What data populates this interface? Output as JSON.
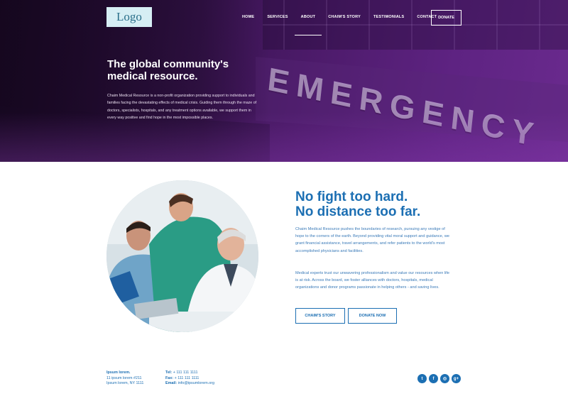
{
  "nav": {
    "logo": "Logo",
    "items": [
      "HOME",
      "SERVICES",
      "ABOUT",
      "CHAIM'S STORY",
      "TESTIMONIALS",
      "CONTACT"
    ],
    "active": "ABOUT",
    "donate_label": "DONATE"
  },
  "hero": {
    "title": "The global community's medical resource.",
    "text": "Chaim Medical Resource is a non-profit organization providing support to individuals and families facing the devastating effects of medical crisis. Guiding them through the maze of doctors, specialists, hospitals, and any treatment options available, we support them in every way positive and find hope in the most impossible places.",
    "background_sign": "EMERGENCY"
  },
  "about": {
    "headline_line1": "No fight too hard.",
    "headline_line2": "No distance too far.",
    "para1": "Chaim Medical Resource pushes the boundaries of research, pursuing any vestige of hope to the corners of the earth. Beyond providing vital moral support and guidance, we grant financial assistance, travel arrangements, and refer patients to the world's most accomplished physicians and facilities.",
    "para2": "Medical experts trust our unwavering professionalism and value our resources when life is at risk. Across the board, we foster alliances with doctors, hospitals, medical organizations and donor programs passionate in helping others - and saving lives.",
    "btn_story": "CHAIM'S STORY",
    "btn_donate": "DONATE NOW"
  },
  "footer": {
    "addr1": "Ipsum lorem.",
    "addr2": "11 ipsum lorem #211",
    "addr3": "Ipsum lorem, NY 1111",
    "tel_label": "Tel:",
    "tel": "+ 111 111 1111",
    "fax_label": "Fax:",
    "fax": "+ 111 111 1111",
    "email_label": "Email:",
    "email": "info@ipsumlorem.org"
  },
  "social": [
    {
      "icon": "twitter-icon",
      "glyph": "t"
    },
    {
      "icon": "facebook-icon",
      "glyph": "f"
    },
    {
      "icon": "instagram-icon",
      "glyph": "◎"
    },
    {
      "icon": "google-plus-icon",
      "glyph": "g+"
    }
  ],
  "colors": {
    "accent": "#1c6fb3",
    "hero": "#4d1b6b"
  }
}
